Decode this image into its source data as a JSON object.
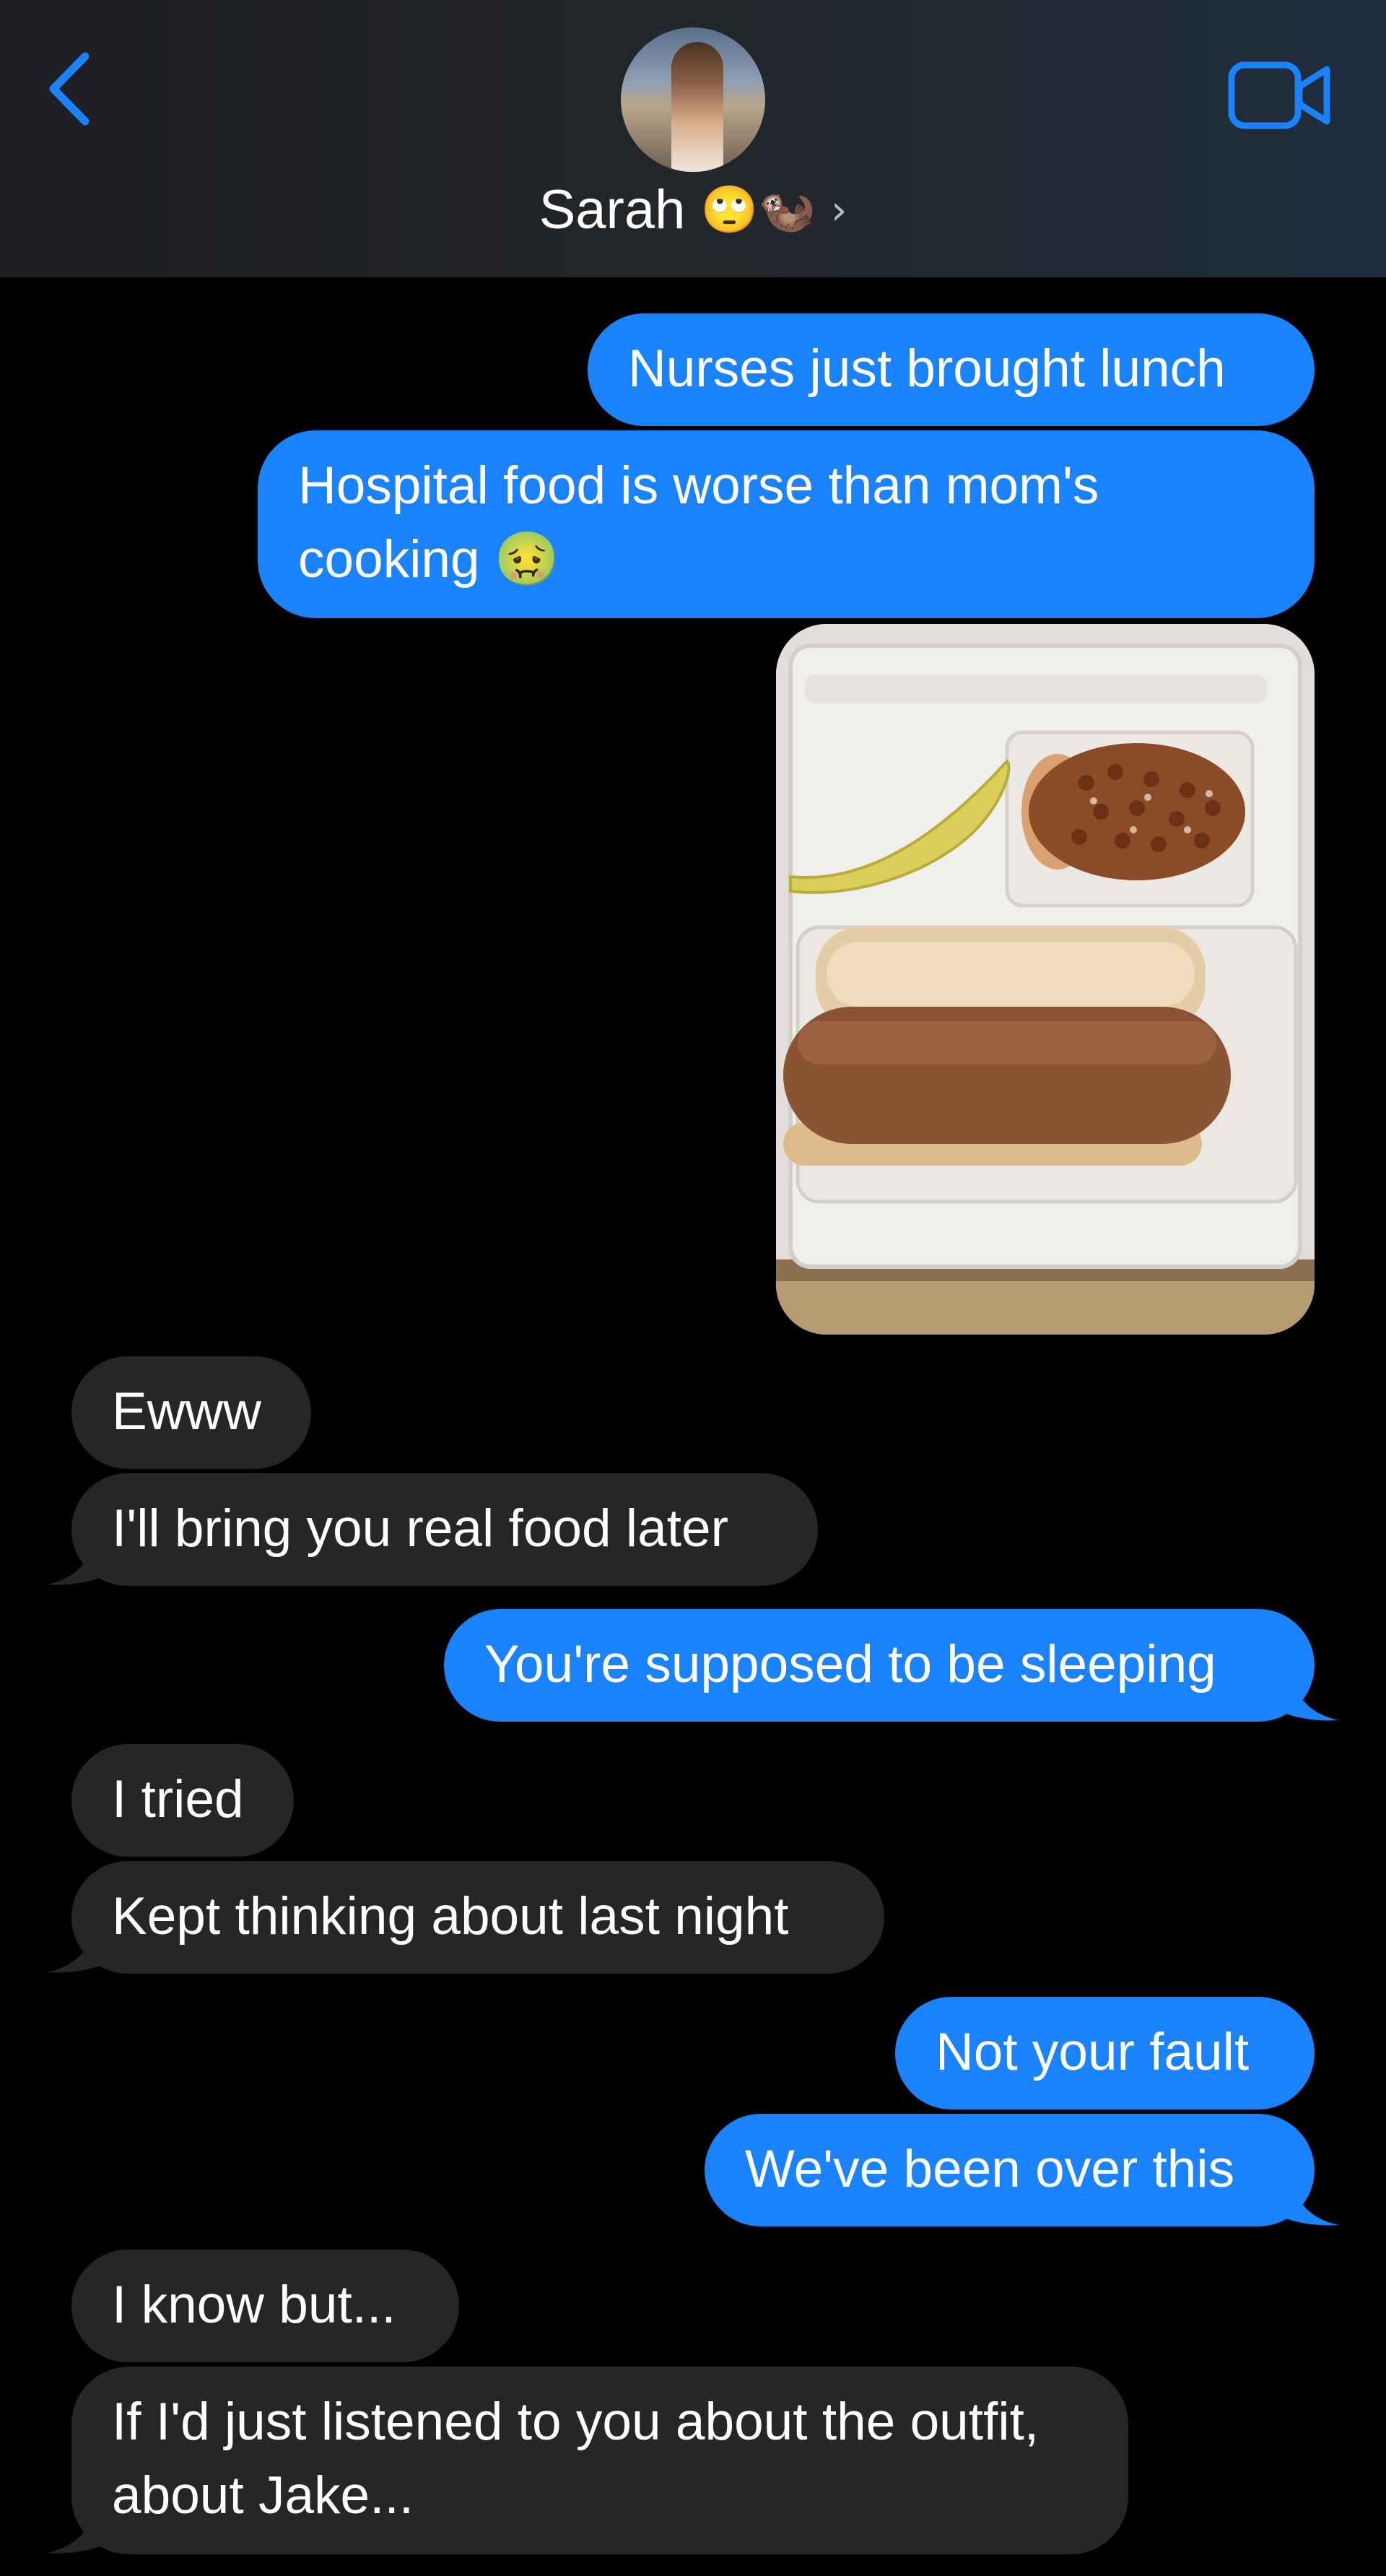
{
  "header": {
    "contact_name": "Sarah",
    "name_emojis": "🙄🦦",
    "back_icon": "chevron-left-icon",
    "video_icon": "video-camera-icon",
    "accent_color": "#1a82fb"
  },
  "messages": [
    {
      "from": "me",
      "text": "Nurses just brought lunch"
    },
    {
      "from": "me",
      "text": "Hospital food is worse than mom's cooking 🤢"
    },
    {
      "from": "me",
      "type": "photo"
    },
    {
      "from": "them",
      "text": "Ewww"
    },
    {
      "from": "them",
      "text": "I'll bring you real food later"
    },
    {
      "from": "me",
      "text": "You're supposed to be sleeping"
    },
    {
      "from": "them",
      "text": "I tried"
    },
    {
      "from": "them",
      "text": "Kept thinking about last night"
    },
    {
      "from": "me",
      "text": "Not your fault"
    },
    {
      "from": "me",
      "text": "We've been over this"
    },
    {
      "from": "them",
      "text": "I know but..."
    },
    {
      "from": "them",
      "text": "If I'd just listened to you about the outfit, about Jake..."
    }
  ],
  "colors": {
    "outgoing_bubble": "#1a82fb",
    "incoming_bubble": "#262628",
    "background": "#000000"
  }
}
